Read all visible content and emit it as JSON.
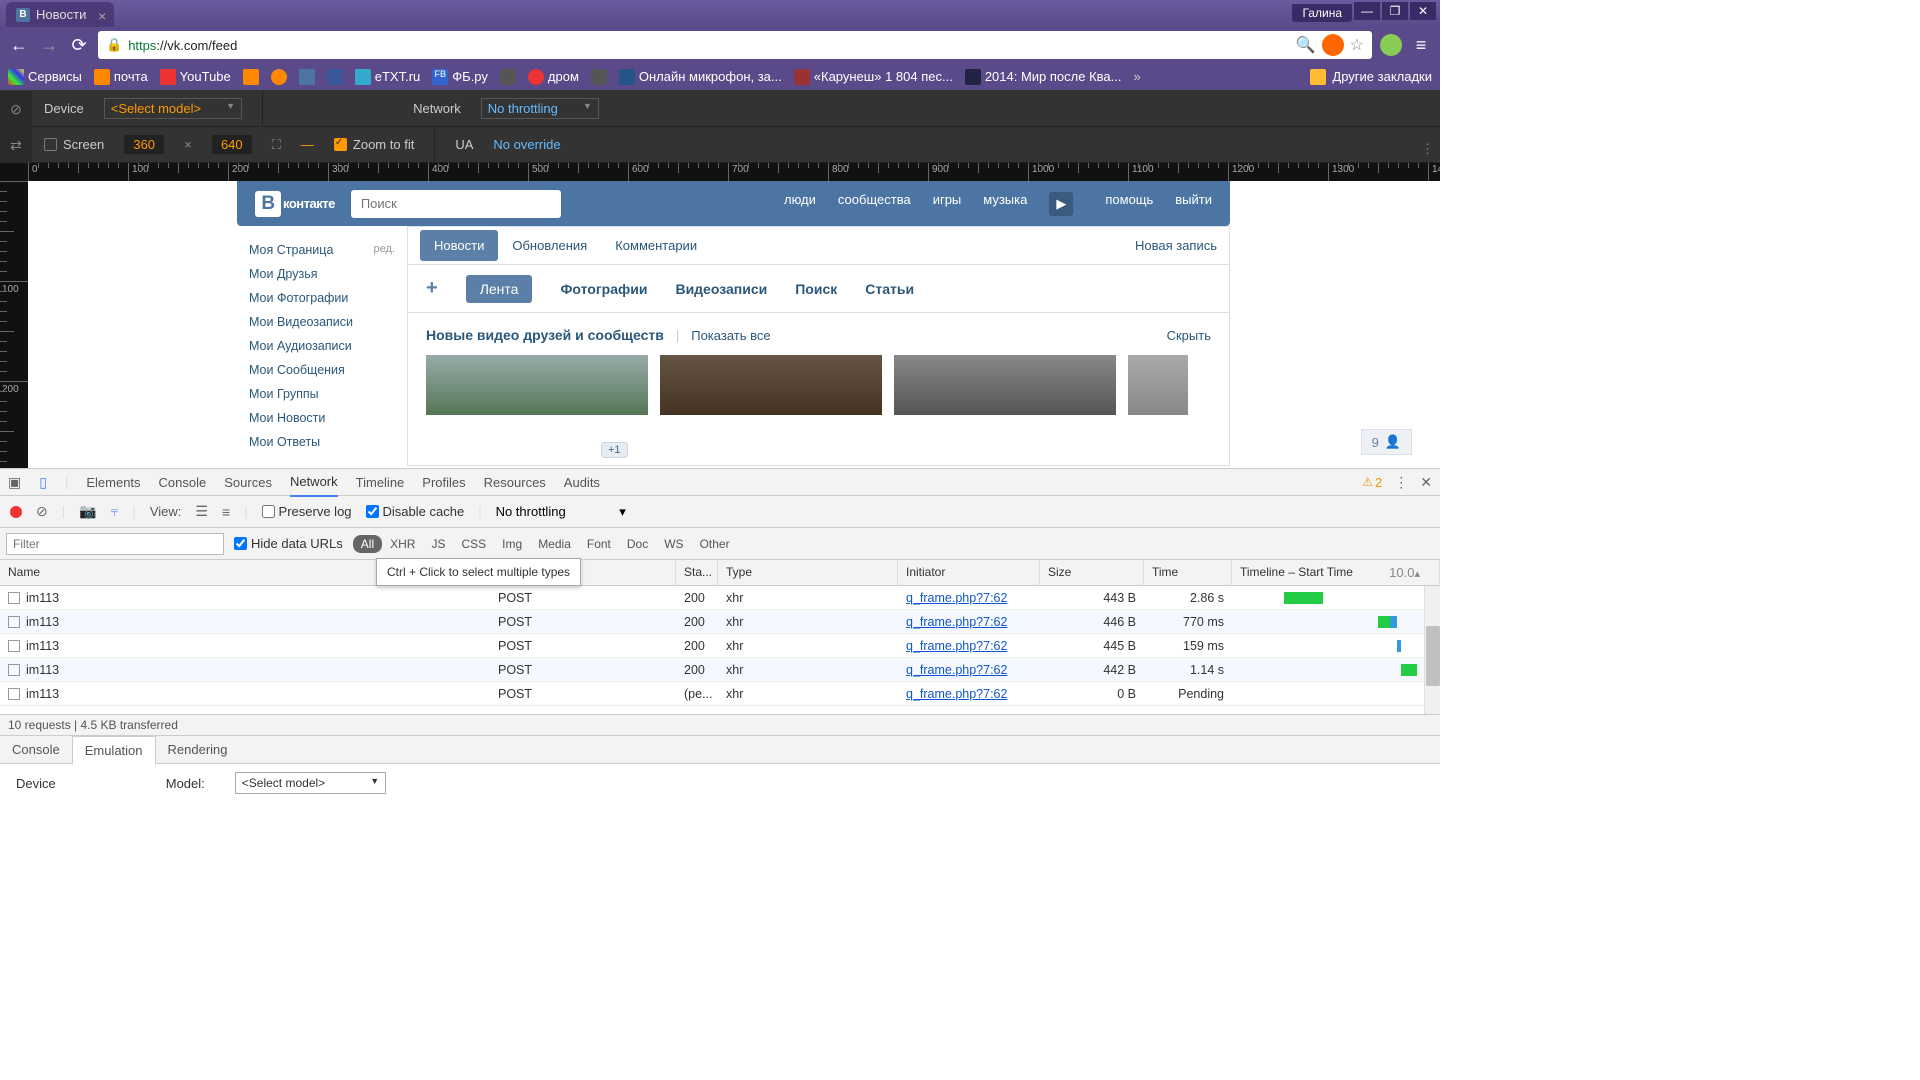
{
  "chrome": {
    "tab_title": "Новости",
    "user": "Галина",
    "url_proto": "https",
    "url_rest": "://vk.com/feed",
    "bookmarks": [
      "Сервисы",
      "почта",
      "YouTube",
      "",
      "",
      "",
      "",
      "eTXT.ru",
      "ФБ.ру",
      "",
      "",
      "дром",
      "",
      "Онлайн микрофон, за...",
      "«Карунеш» 1 804 пес...",
      "2014: Мир после Ква..."
    ],
    "bm_more": "Другие закладки"
  },
  "device_bar": {
    "device": "Device",
    "select_model": "<Select model>",
    "network": "Network",
    "no_throttling": "No throttling",
    "screen": "Screen",
    "w": "360",
    "h": "640",
    "zoom": "Zoom to fit",
    "ua": "UA",
    "no_override": "No override"
  },
  "vk": {
    "logo": "контакте",
    "search_ph": "Поиск",
    "nav": [
      "люди",
      "сообщества",
      "игры",
      "музыка"
    ],
    "nav_right": [
      "помощь",
      "выйти"
    ],
    "side": [
      {
        "label": "Моя Страница",
        "edit": "ред."
      },
      {
        "label": "Мои Друзья"
      },
      {
        "label": "Мои Фотографии"
      },
      {
        "label": "Мои Видеозаписи"
      },
      {
        "label": "Мои Аудиозаписи"
      },
      {
        "label": "Мои Сообщения"
      },
      {
        "label": "Мои Группы"
      },
      {
        "label": "Мои Новости"
      },
      {
        "label": "Мои Ответы"
      }
    ],
    "plus1": "+1",
    "tabs": [
      "Новости",
      "Обновления",
      "Комментарии"
    ],
    "tab_right": "Новая запись",
    "subtabs": [
      "Лента",
      "Фотографии",
      "Видеозаписи",
      "Поиск",
      "Статьи"
    ],
    "section_title": "Новые видео друзей и сообществ",
    "show_all": "Показать все",
    "hide": "Скрыть",
    "counter": "9"
  },
  "devtools": {
    "tabs": [
      "Elements",
      "Console",
      "Sources",
      "Network",
      "Timeline",
      "Profiles",
      "Resources",
      "Audits"
    ],
    "warn_count": "2",
    "view": "View:",
    "preserve": "Preserve log",
    "disable_cache": "Disable cache",
    "throttle": "No throttling",
    "filter_ph": "Filter",
    "hide_urls": "Hide data URLs",
    "pills": [
      "All",
      "XHR",
      "JS",
      "CSS",
      "Img",
      "Media",
      "Font",
      "Doc",
      "WS",
      "Other"
    ],
    "tooltip": "Ctrl + Click to select multiple types",
    "cols": [
      "Name",
      "",
      "Sta...",
      "Type",
      "Initiator",
      "Size",
      "Time",
      "Timeline – Start Time"
    ],
    "tl_end": "10.0",
    "rows": [
      {
        "name": "im113",
        "method": "POST",
        "status": "200",
        "type": "xhr",
        "init": "q_frame.php?7:62",
        "size": "443 B",
        "time": "2.86 s",
        "bar": [
          {
            "l": 23,
            "w": 20,
            "c": "g"
          }
        ]
      },
      {
        "name": "im113",
        "method": "POST",
        "status": "200",
        "type": "xhr",
        "init": "q_frame.php?7:62",
        "size": "446 B",
        "time": "770 ms",
        "bar": [
          {
            "l": 72,
            "w": 6,
            "c": "g"
          },
          {
            "l": 78,
            "w": 4,
            "c": "b"
          }
        ]
      },
      {
        "name": "im113",
        "method": "POST",
        "status": "200",
        "type": "xhr",
        "init": "q_frame.php?7:62",
        "size": "445 B",
        "time": "159 ms",
        "bar": [
          {
            "l": 82,
            "w": 2,
            "c": "b"
          }
        ]
      },
      {
        "name": "im113",
        "method": "POST",
        "status": "200",
        "type": "xhr",
        "init": "q_frame.php?7:62",
        "size": "442 B",
        "time": "1.14 s",
        "bar": [
          {
            "l": 84,
            "w": 8,
            "c": "g"
          }
        ]
      },
      {
        "name": "im113",
        "method": "POST",
        "status": "(pe...",
        "type": "xhr",
        "init": "q_frame.php?7:62",
        "size": "0 B",
        "time": "Pending",
        "bar": [
          {
            "l": 96,
            "w": 2,
            "c": "b"
          }
        ]
      }
    ],
    "status": "10 requests  |  4.5 KB transferred",
    "drawer_tabs": [
      "Console",
      "Emulation",
      "Rendering"
    ],
    "drawer_device": "Device",
    "drawer_model": "Model:",
    "drawer_sel": "<Select model>"
  }
}
